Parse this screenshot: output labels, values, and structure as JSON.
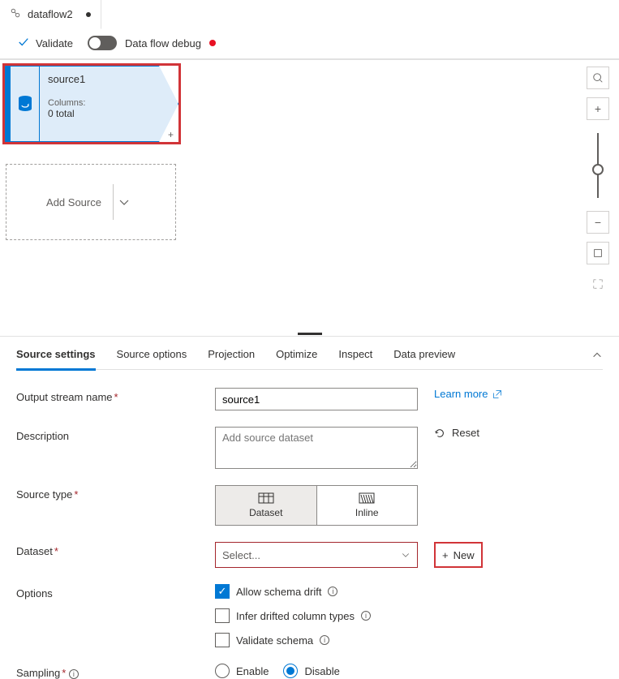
{
  "tab": {
    "title": "dataflow2"
  },
  "toolbar": {
    "validate": "Validate",
    "debug": "Data flow debug"
  },
  "source_node": {
    "title": "source1",
    "columns_label": "Columns:",
    "columns_value": "0 total"
  },
  "add_source": "Add Source",
  "panel": {
    "tabs": [
      "Source settings",
      "Source options",
      "Projection",
      "Optimize",
      "Inspect",
      "Data preview"
    ]
  },
  "form": {
    "output_stream_label": "Output stream name",
    "output_stream_value": "source1",
    "learn_more": "Learn more",
    "description_label": "Description",
    "description_placeholder": "Add source dataset",
    "reset": "Reset",
    "source_type_label": "Source type",
    "seg_dataset": "Dataset",
    "seg_inline": "Inline",
    "dataset_label": "Dataset",
    "dataset_placeholder": "Select...",
    "new_label": "New",
    "options_label": "Options",
    "opt_allow": "Allow schema drift",
    "opt_infer": "Infer drifted column types",
    "opt_validate": "Validate schema",
    "sampling_label": "Sampling",
    "sampling_enable": "Enable",
    "sampling_disable": "Disable"
  }
}
